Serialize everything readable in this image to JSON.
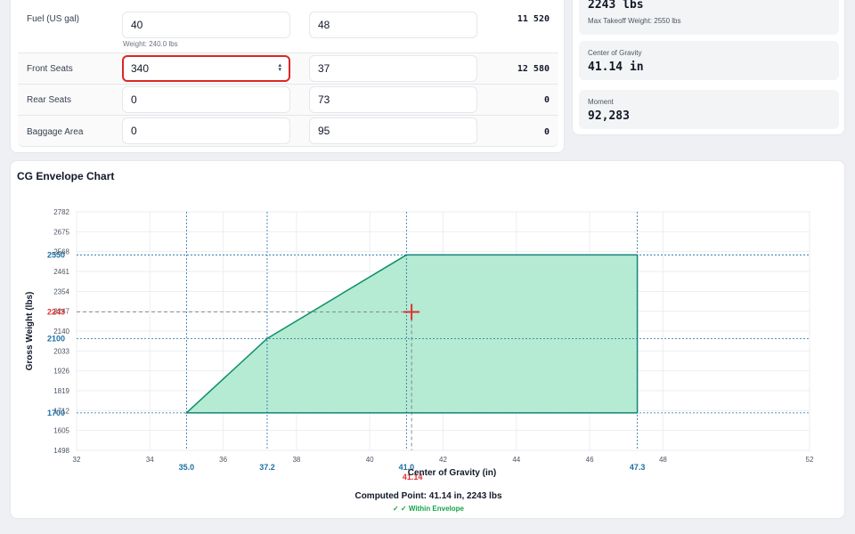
{
  "loading": {
    "rows": [
      {
        "label": "Fuel (US gal)",
        "weight": "40",
        "arm": "48",
        "moment": "11 520",
        "hint": "Weight: 240.0 lbs"
      },
      {
        "label": "Front Seats",
        "weight": "340",
        "arm": "37",
        "moment": "12 580"
      },
      {
        "label": "Rear Seats",
        "weight": "0",
        "arm": "73",
        "moment": "0"
      },
      {
        "label": "Baggage Area",
        "weight": "0",
        "arm": "95",
        "moment": "0"
      }
    ]
  },
  "summary": {
    "gross_weight": "2243 lbs",
    "max_takeoff": "Max Takeoff Weight: 2550 lbs",
    "cg_title": "Center of Gravity",
    "cg_value": "41.14 in",
    "moment_title": "Moment",
    "moment_value": "92,283"
  },
  "chart": {
    "title": "CG Envelope Chart",
    "computed_text": "Computed Point: 41.14 in, 2243 lbs",
    "status_text": "✓ ✓ Within Envelope",
    "colors": {
      "envelope_fill": "#b5ead3",
      "envelope_stroke": "#0f8f6a",
      "ref_blue": "#1d6fa5",
      "point_red": "#e03131"
    }
  },
  "chart_data": {
    "type": "area",
    "xlabel": "Center of Gravity (in)",
    "ylabel": "Gross Weight (lbs)",
    "xlim": [
      32,
      52
    ],
    "ylim": [
      1498,
      2782
    ],
    "x_ticks": [
      32,
      34,
      36,
      38,
      40,
      42,
      44,
      46,
      48,
      52
    ],
    "y_ticks": [
      1498,
      1605,
      1712,
      1819,
      1926,
      2033,
      2140,
      2247,
      2354,
      2461,
      2568,
      2675,
      2782
    ],
    "grid": true,
    "envelope": {
      "x": [
        35.0,
        37.2,
        41.0,
        47.3,
        47.3
      ],
      "y": [
        1700,
        2100,
        2550,
        2550,
        1700
      ]
    },
    "reference_x": [
      {
        "value": 35.0,
        "label": "35.0"
      },
      {
        "value": 37.2,
        "label": "37.2"
      },
      {
        "value": 41.0,
        "label": "41.0"
      },
      {
        "value": 47.3,
        "label": "47.3"
      }
    ],
    "reference_y": [
      {
        "value": 2550,
        "label": "2550"
      },
      {
        "value": 2100,
        "label": "2100"
      },
      {
        "value": 1700,
        "label": "1700"
      }
    ],
    "point": {
      "x": 41.14,
      "y": 2243,
      "x_label": "41.14",
      "y_label": "2243"
    }
  }
}
